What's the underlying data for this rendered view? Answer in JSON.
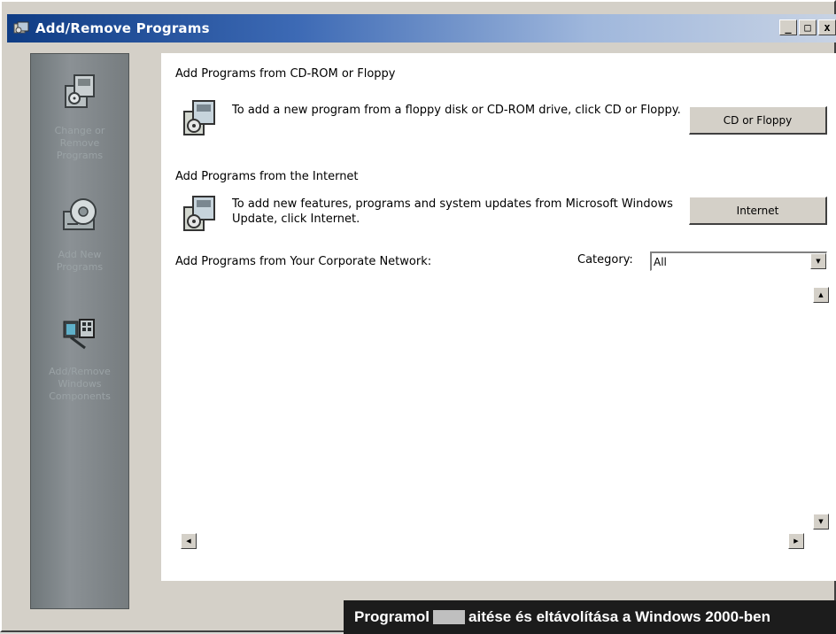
{
  "window": {
    "title": "Add/Remove Programs",
    "controls": {
      "minimize": "_",
      "maximize": "□",
      "close": "x"
    }
  },
  "sidebar": {
    "items": [
      {
        "label": "Change or\nRemove\nPrograms",
        "icon": "install-box-icon"
      },
      {
        "label": "Add New\nPrograms",
        "icon": "cd-disk-icon"
      },
      {
        "label": "Add/Remove\nWindows\nComponents",
        "icon": "windows-components-icon"
      }
    ]
  },
  "main": {
    "sections": [
      {
        "title": "Add Programs from CD-ROM or Floppy",
        "description": "To add a new program from a floppy disk or CD-ROM drive, click CD or Floppy.",
        "button": "CD or Floppy"
      },
      {
        "title": "Add Programs from the Internet",
        "description": "To add new features, programs and system updates from Microsoft Windows Update, click Internet.",
        "button": "Internet"
      }
    ],
    "network_title": "Add Programs from Your Corporate Network:",
    "category_label": "Category:",
    "category_value": "All"
  },
  "caption": {
    "part1": "Programol",
    "part2": "aitése és eltávolítása a Windows 2000-ben"
  },
  "colors": {
    "titlebar_start": "#0f3c84",
    "titlebar_end": "#c8d3e4",
    "sidebar": "#8b9195",
    "window": "#d4d0c8"
  }
}
